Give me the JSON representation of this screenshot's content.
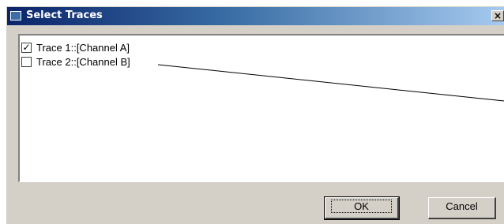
{
  "window": {
    "title": "Select Traces",
    "close_label": "×"
  },
  "list": {
    "items": [
      {
        "label": "Trace 1::[Channel A]",
        "checked": true
      },
      {
        "label": "Trace 2::[Channel B]",
        "checked": false
      }
    ]
  },
  "buttons": {
    "ok_label": "OK",
    "cancel_label": "Cancel"
  }
}
